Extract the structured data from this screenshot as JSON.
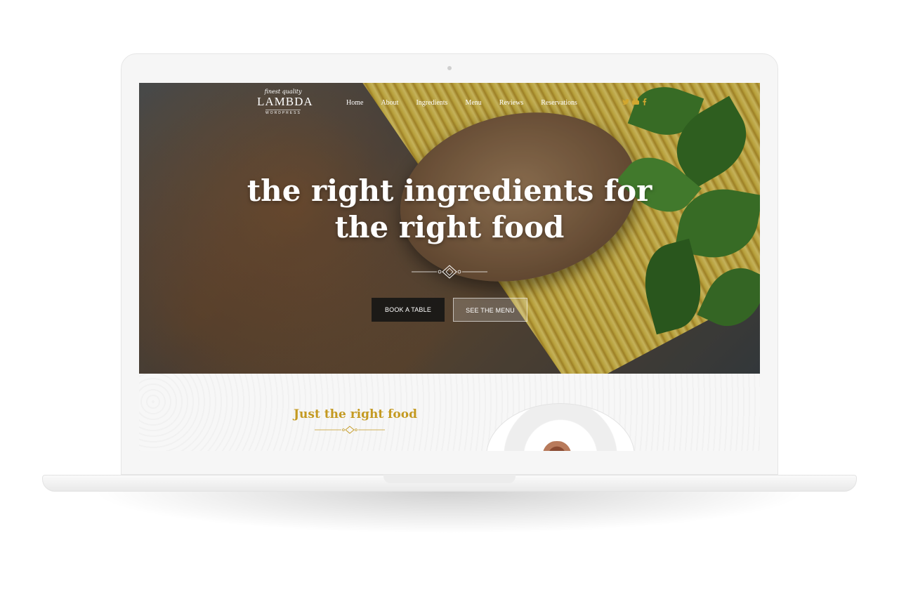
{
  "header": {
    "logo": {
      "top": "finest quality",
      "main": "LAMBDA",
      "sub": "WORDPRESS"
    },
    "nav": [
      "Home",
      "About",
      "Ingredients",
      "Menu",
      "Reviews",
      "Reservations"
    ],
    "social_icons": [
      "twitter-icon",
      "youtube-icon",
      "facebook-icon"
    ]
  },
  "hero": {
    "headline_line1": "the right ingredients for",
    "headline_line2": "the right food",
    "book_label": "BOOK A TABLE",
    "menu_label": "SEE THE MENU"
  },
  "section": {
    "title": "Just the right food"
  },
  "colors": {
    "accent_gold": "#c49a22",
    "button_dark": "#141414"
  }
}
